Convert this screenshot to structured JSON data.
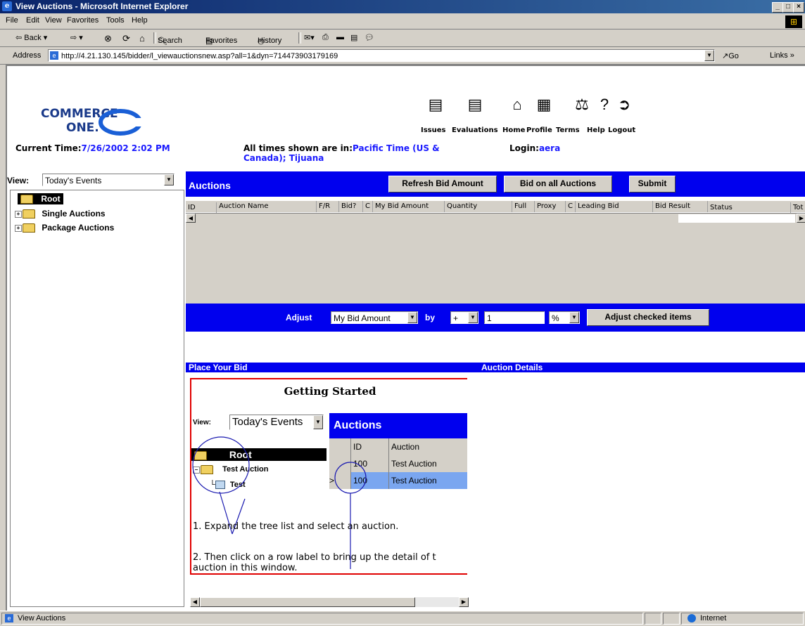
{
  "window": {
    "title": "View Auctions - Microsoft Internet Explorer"
  },
  "menu": [
    "File",
    "Edit",
    "View",
    "Favorites",
    "Tools",
    "Help"
  ],
  "toolbar": {
    "back": "⇦ Back ▾",
    "forward": "⇨ ▾",
    "search": "Search",
    "favorites": "Favorites",
    "history": "History"
  },
  "address": {
    "label": "Address",
    "url": "http://4.21.130.145/bidder/l_viewauctionsnew.asp?all=1&dyn=714473903179169",
    "go": "Go",
    "links": "Links »"
  },
  "header": {
    "logo_line1": "COMMERCE",
    "logo_line2": "ONE.",
    "current_time_label": "Current Time:",
    "current_time": "7/26/2002 2:02 PM",
    "tz_label": "All times shown are in:",
    "tz_value1": "Pacific Time (US &",
    "tz_value2": "Canada); Tijuana",
    "login_label": "Login:",
    "login_value": "aera",
    "icons": [
      {
        "label": "Issues",
        "icon": "issues-icon"
      },
      {
        "label": "Evaluations",
        "icon": "evaluations-icon"
      },
      {
        "label": "Home",
        "icon": "home-icon"
      },
      {
        "label": "Profile",
        "icon": "profile-icon"
      },
      {
        "label": "Terms",
        "icon": "terms-icon"
      },
      {
        "label": "Help",
        "icon": "help-icon"
      },
      {
        "label": "Logout",
        "icon": "logout-icon"
      }
    ]
  },
  "sidebar": {
    "view_label": "View:",
    "view_value": "Today's Events",
    "tree": {
      "root": "Root",
      "items": [
        "Single Auctions",
        "Package Auctions"
      ]
    }
  },
  "auctions": {
    "title": "Auctions",
    "buttons": {
      "refresh": "Refresh Bid Amount",
      "bid_all": "Bid on all Auctions",
      "submit": "Submit"
    },
    "columns": [
      "ID",
      "Auction Name",
      "F/R",
      "Bid?",
      "C",
      "My Bid Amount",
      "Quantity",
      "Full",
      "Proxy",
      "C",
      "Leading Bid",
      "Bid Result",
      "Status",
      "Tot"
    ]
  },
  "adjust": {
    "label": "Adjust",
    "field": "My Bid Amount",
    "by": "by",
    "sign": "+",
    "amount": "1",
    "unit": "%",
    "button": "Adjust checked items"
  },
  "place_bid": {
    "title": "Place Your Bid"
  },
  "auction_details": {
    "title": "Auction Details"
  },
  "getting_started": {
    "title": "Getting Started",
    "view_label": "View:",
    "view_value": "Today's Events",
    "auctions_label": "Auctions",
    "tree_root": "Root",
    "tree_item": "Test Auction",
    "tree_child": "Test",
    "table_headers": [
      "ID",
      "Auction"
    ],
    "rows": [
      {
        "marker": "",
        "id": "100",
        "name": "Test Auction"
      },
      {
        "marker": ">",
        "id": "100",
        "name": "Test Auction"
      }
    ],
    "step1": "1. Expand the tree list and select an auction.",
    "step2a": "2. Then click on a row label to bring up the detail of t",
    "step2b": "auction in this window."
  },
  "status": {
    "text": "View Auctions",
    "zone": "Internet"
  },
  "colors": {
    "blue_band": "#0000ee",
    "title_bar": "#0a246a",
    "accent_text": "#1a1aff",
    "callout_red": "#e00000"
  }
}
